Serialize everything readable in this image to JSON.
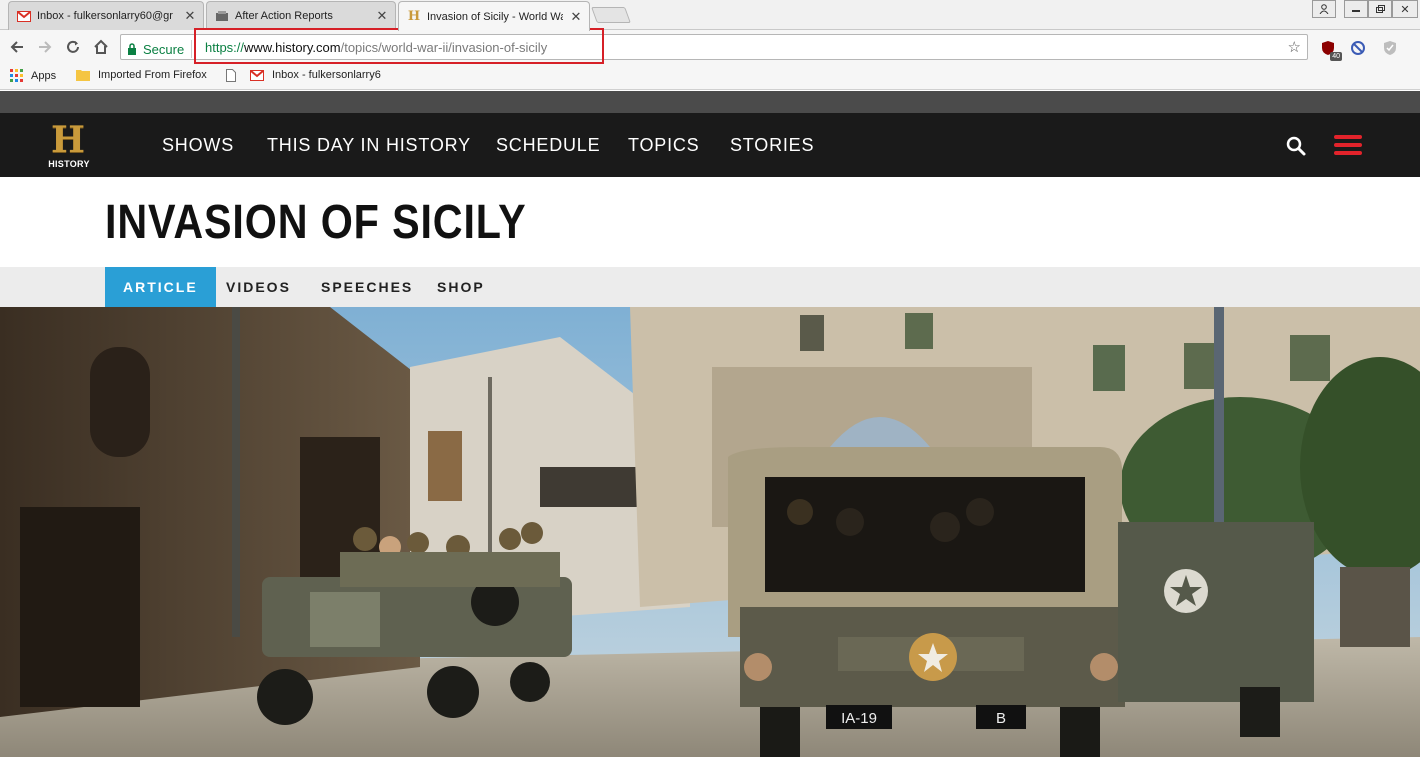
{
  "browser": {
    "tabs": [
      {
        "title": "Inbox - fulkersonlarry60@gr",
        "icon": "gmail-icon",
        "active": false
      },
      {
        "title": "After Action Reports",
        "icon": "site-icon",
        "active": false
      },
      {
        "title": "Invasion of Sicily - World Wa",
        "icon": "history-h-icon",
        "active": true
      }
    ],
    "secure_label": "Secure",
    "url": {
      "scheme": "https://",
      "host": "www.history.com",
      "path": "/topics/world-war-ii/invasion-of-sicily"
    },
    "extension_badge": "40",
    "bookmarks": [
      {
        "label": "Apps",
        "icon": "apps-grid-icon"
      },
      {
        "label": "Imported From Firefox",
        "icon": "folder-icon"
      },
      {
        "label": "",
        "icon": "page-icon"
      },
      {
        "label": "Inbox - fulkersonlarry6",
        "icon": "gmail-icon"
      }
    ],
    "colors": {
      "secure_green": "#0b8043",
      "highlight_red": "#d62027"
    }
  },
  "site": {
    "logo_text": "HISTORY",
    "nav": [
      "SHOWS",
      "THIS DAY IN HISTORY",
      "SCHEDULE",
      "TOPICS",
      "STORIES"
    ],
    "page_title": "INVASION OF SICILY",
    "subnav": [
      "ARTICLE",
      "VIDEOS",
      "SPEECHES",
      "SHOP"
    ],
    "hero_plates": {
      "front": "IA-19",
      "side": "B"
    },
    "colors": {
      "nav_bg": "#1a1a1a",
      "accent_blue": "#2a9fd6",
      "menu_red": "#e2232b",
      "logo_gold": "#c99a3b"
    }
  }
}
